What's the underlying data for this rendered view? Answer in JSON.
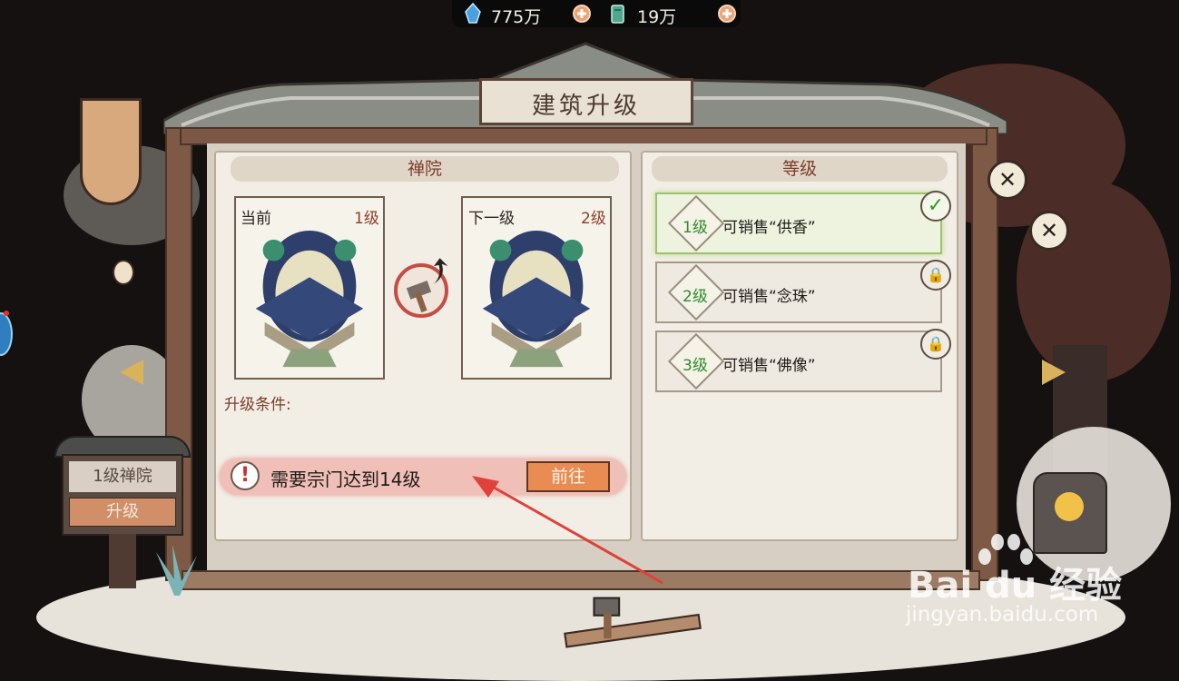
{
  "resources": [
    {
      "icon": "spirit-stone-icon",
      "value": "775万"
    },
    {
      "icon": "wood-icon",
      "value": "19万"
    }
  ],
  "dialog": {
    "title": "建筑升级",
    "building_panel": {
      "header": "禅院",
      "current": {
        "label": "当前",
        "level": "1级"
      },
      "next": {
        "label": "下一级",
        "level": "2级"
      },
      "conditions_label": "升级条件:",
      "requirement": {
        "text": "需要宗门达到14级",
        "button": "前往"
      }
    },
    "level_panel": {
      "header": "等级",
      "levels": [
        {
          "num": "1级",
          "text": "可销售“供香”",
          "state": "unlocked"
        },
        {
          "num": "2级",
          "text": "可销售“念珠”",
          "state": "locked"
        },
        {
          "num": "3级",
          "text": "可销售“佛像”",
          "state": "locked"
        }
      ]
    }
  },
  "side_sign": {
    "title": "1级禅院",
    "button": "升级"
  },
  "watermark": {
    "main": "Bai du 经验",
    "sub": "jingyan.baidu.com"
  },
  "colors": {
    "accent_red": "#e0413a",
    "go_button": "#e98c53",
    "active_level": "#9cc26f"
  }
}
